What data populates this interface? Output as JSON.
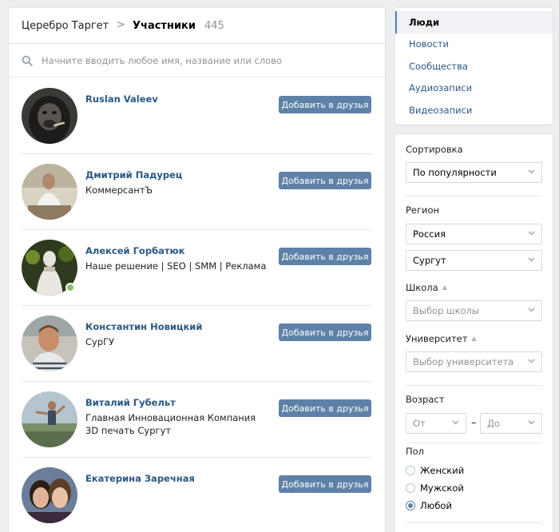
{
  "header": {
    "community": "Церебро Таргет",
    "separator": ">",
    "current": "Участники",
    "count": "445"
  },
  "search": {
    "placeholder": "Начните вводить любое имя, название или слово"
  },
  "add_friend_label": "Добавить в друзья",
  "members": [
    {
      "name": "Ruslan Valeev",
      "desc": "",
      "online": false
    },
    {
      "name": "Дмитрий Падурец",
      "desc": "КоммерсантЪ",
      "online": false
    },
    {
      "name": "Алексей Горбатюк",
      "desc": "Наше решение | SEO | SMM | Реклама",
      "online": true
    },
    {
      "name": "Константин Новицкий",
      "desc": "СурГУ",
      "online": false
    },
    {
      "name": "Виталий Губельт",
      "desc": "Главная Инновационная Компания 3D печать Сургут",
      "online": false
    },
    {
      "name": "Екатерина Заречная",
      "desc": "",
      "online": false
    }
  ],
  "side_menu": {
    "items": [
      "Люди",
      "Новости",
      "Сообщества",
      "Аудиозаписи",
      "Видеозаписи"
    ],
    "active_index": 0
  },
  "filters": {
    "sort_label": "Сортировка",
    "sort_value": "По популярности",
    "region_label": "Регион",
    "country_value": "Россия",
    "city_value": "Сургут",
    "school_label": "Школа",
    "school_placeholder": "Выбор школы",
    "university_label": "Университет",
    "university_placeholder": "Выбор университета",
    "age_label": "Возраст",
    "age_from": "От",
    "age_dash": "–",
    "age_to": "До",
    "gender_label": "Пол",
    "gender_options": [
      "Женский",
      "Мужской",
      "Любой"
    ],
    "gender_selected": 2
  },
  "colors": {
    "link": "#2a5885",
    "button": "#5e81a8",
    "online": "#8ac176",
    "background": "#edeef0"
  }
}
